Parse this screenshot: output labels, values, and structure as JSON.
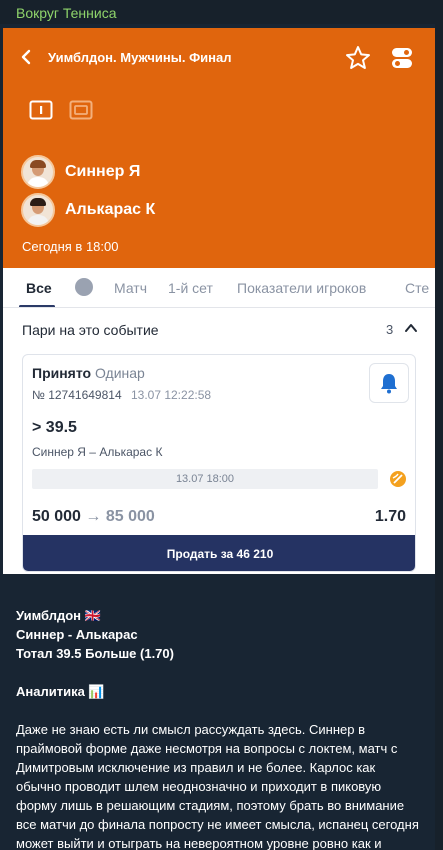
{
  "channel": {
    "name": "Вокруг Тенниса"
  },
  "event": {
    "title": "Уимблдон. Мужчины. Финал",
    "players": [
      "Синнер Я",
      "Алькарас К"
    ],
    "start": "Сегодня в 18:00"
  },
  "tabs": [
    "Все",
    "Матч",
    "1-й сет",
    "Показатели игроков",
    "Сте"
  ],
  "bets": {
    "title": "Пари на это событие",
    "count": "3",
    "card": {
      "status": "Принято",
      "type": "Одинар",
      "id": "№ 12741649814",
      "date": "13.07   12:22:58",
      "line": "> 39.5",
      "match": "Синнер Я – Алькарас К",
      "event_date": "13.07 18:00",
      "stake": "50 000",
      "arrow": "→",
      "payout": "85 000",
      "odds": "1.70",
      "sell_label": "Продать за 46 210"
    }
  },
  "post": {
    "line1": "Уимблдон 🇬🇧",
    "line2": "Синнер - Алькарас",
    "line3": "Тотал 39.5 Больше (1.70)",
    "analytics": "Аналитика 📊",
    "body": "Даже не знаю есть ли смысл рассуждать здесь. Синнер в праймовой форме даже несмотря на вопросы с локтем, матч с Димитровым исключение из правил и не более. Карлос как обычно проводит шлем неоднозначно и приходит в пиковую форму лишь в решающим стадиям, поэтому брать во внимание все матчи до финала попросту не имеет смысла, испанец сегодня может выйти и отыграть на невероятном уровне ровно как и итальянец. Поэтому мой выбор незамысловат - верховая игра. В идеале хочу снова увидеть пять сетов и чемпионский"
  },
  "colors": {
    "header_bg": "#e0650d",
    "sell_button": "#253363",
    "channel_name": "#8fd46b"
  }
}
